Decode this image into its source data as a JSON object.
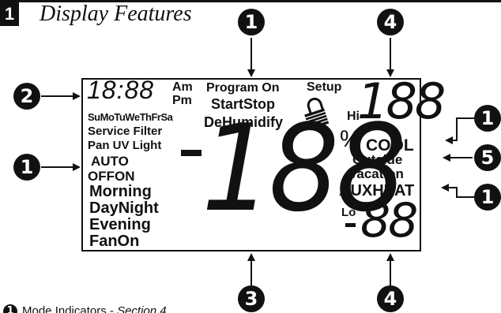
{
  "header": {
    "section_number": "1",
    "title": "Display Features"
  },
  "lcd": {
    "time": "18:88",
    "am": "Am",
    "pm": "Pm",
    "days": "SuMoTuWeThFrSa",
    "service_filter": "Service Filter",
    "pan_uv_light": "Pan UV Light",
    "auto": "AUTO",
    "offon": "OFFON",
    "morning": "Morning",
    "daynight": "DayNight",
    "evening": "Evening",
    "fanon": "FanOn",
    "program_on": "Program On",
    "startstop": "StartStop",
    "dehumidify": "DeHumidify",
    "setup": "Setup",
    "hi": "Hi",
    "hi_digits": "188",
    "percent": "%",
    "cool": "COOL",
    "outside": "Outside",
    "vacation": "Vacation",
    "auxheat": "AUXHEAT",
    "lo": "Lo",
    "lo_digits": "88",
    "big_digits": "188"
  },
  "callouts": {
    "top_center": "1",
    "top_right": "4",
    "left_upper": "2",
    "left_lower": "1",
    "right_upper": "1",
    "right_middle": "5",
    "right_lower": "1",
    "bottom_center": "3",
    "bottom_right": "4"
  },
  "legend": {
    "number": "1",
    "label": "Mode Indicators",
    "separator": " - ",
    "section": "Section 4"
  },
  "icons": {
    "padlock": "padlock-icon",
    "arrow": "arrow-icon"
  }
}
